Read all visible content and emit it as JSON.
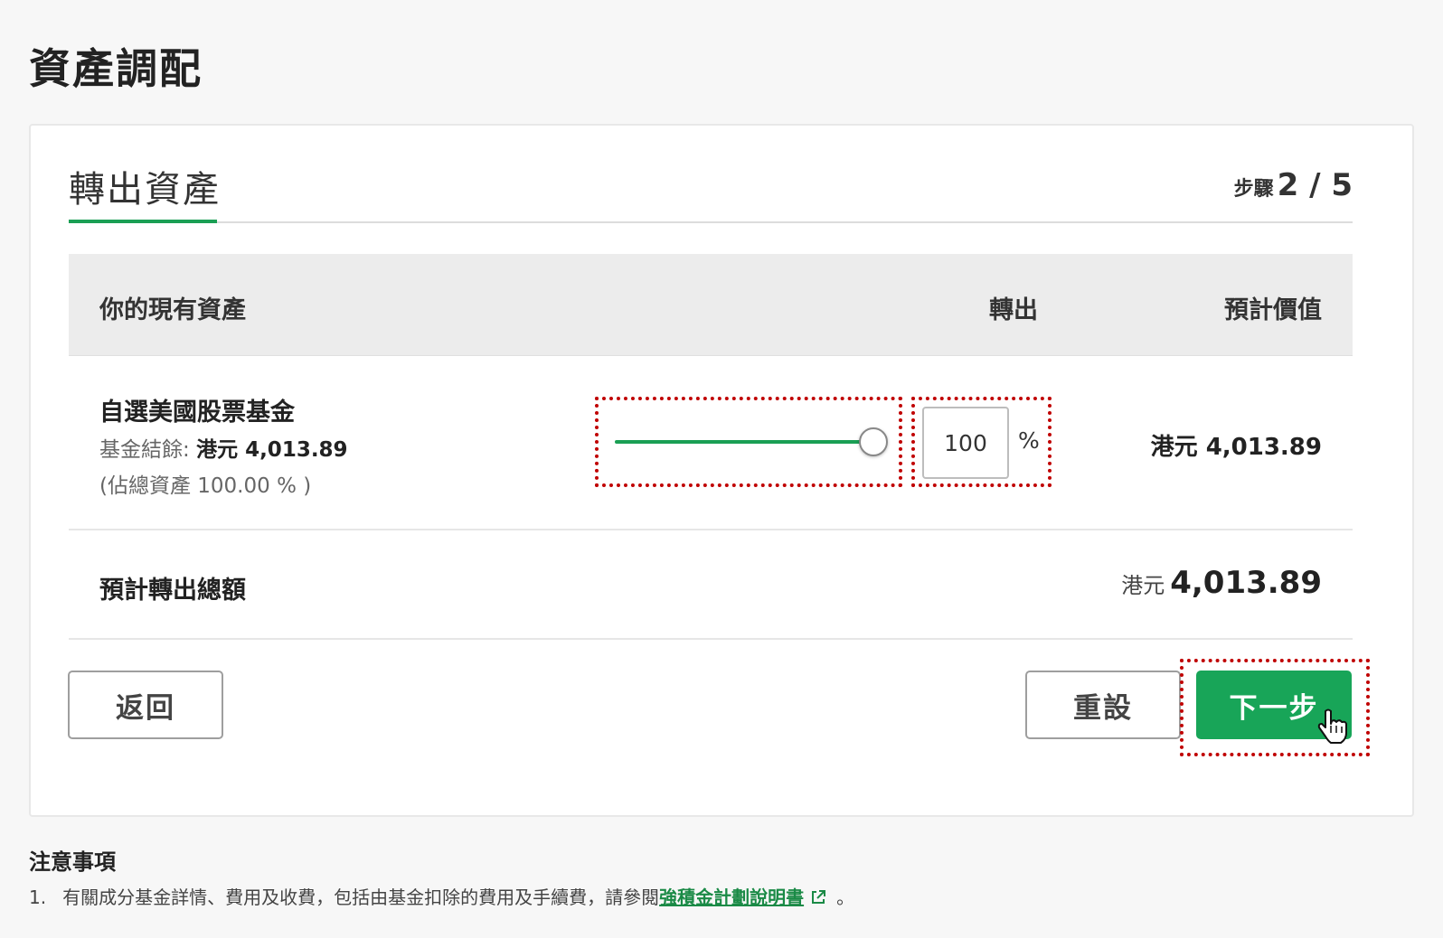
{
  "page": {
    "title": "資產調配"
  },
  "card": {
    "section_title": "轉出資產",
    "step_label": "步驟",
    "step_value": "2 / 5"
  },
  "table": {
    "headers": {
      "assets": "你的現有資產",
      "transfer_out": "轉出",
      "estimated_value": "預計價值"
    },
    "rows": [
      {
        "fund_name": "自選美國股票基金",
        "balance_label": "基金結餘:",
        "balance_value": "港元 4,013.89",
        "share_text": "(佔總資產 100.00 % )",
        "percent_value": "100",
        "percent_unit": "%",
        "slider_fraction": 1.0,
        "estimated_value": "港元 4,013.89"
      }
    ],
    "total": {
      "label": "預計轉出總額",
      "currency": "港元",
      "amount": "4,013.89"
    }
  },
  "buttons": {
    "back": "返回",
    "reset": "重設",
    "next": "下一步"
  },
  "notes": {
    "title": "注意事項",
    "items": [
      {
        "num": "1.",
        "text": "有關成分基金詳情、費用及收費，包括由基金扣除的費用及手續費，請參閱",
        "link_text": "強積金計劃說明書",
        "end": "。"
      }
    ]
  },
  "colors": {
    "accent": "#18a558",
    "highlight_border": "#c00000",
    "header_bg": "#ececec"
  },
  "icons": {
    "external_link": "external-link-icon",
    "cursor": "hand-pointer-icon"
  }
}
